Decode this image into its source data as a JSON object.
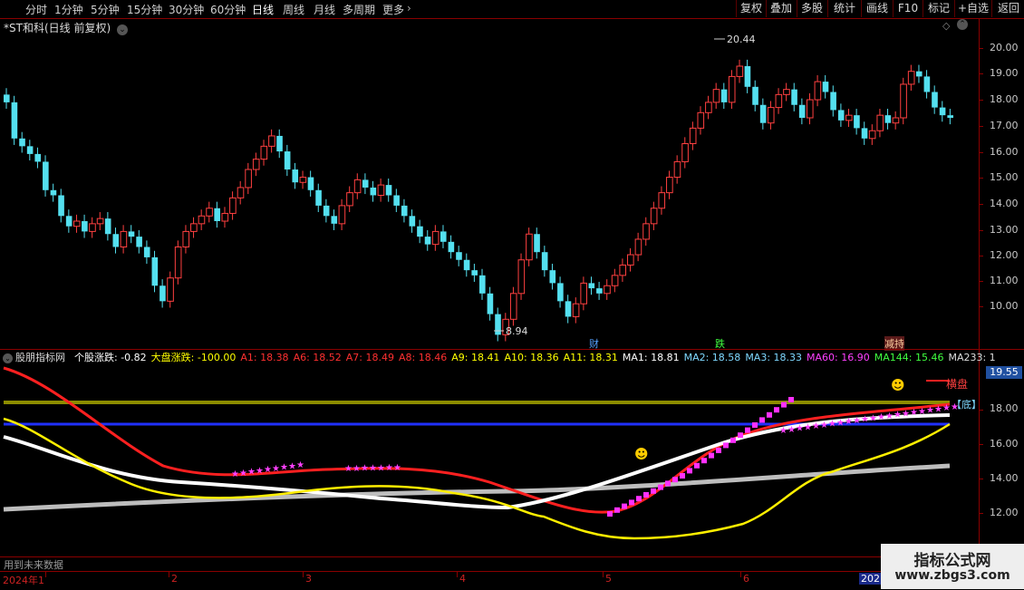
{
  "toolbar": {
    "periods": [
      "分时",
      "1分钟",
      "5分钟",
      "15分钟",
      "30分钟",
      "60分钟",
      "日线",
      "周线",
      "月线",
      "多周期",
      "更多"
    ],
    "active_period": "日线",
    "buttons": [
      "复权",
      "叠加",
      "多股",
      "统计",
      "画线",
      "F10",
      "标记",
      "+自选",
      "返回"
    ]
  },
  "stock": {
    "title": "*ST和科(日线 前复权)"
  },
  "price_axis": {
    "labels": [
      "20.00",
      "19.00",
      "18.00",
      "17.00",
      "16.00",
      "15.00",
      "14.00",
      "13.00",
      "12.00",
      "11.00",
      "10.00"
    ]
  },
  "annotations": {
    "high": "20.44",
    "low": "8.94",
    "event_1": "财",
    "event_2": "跌",
    "event_3": "减持"
  },
  "indicator": {
    "name": "股朋指标网",
    "items": [
      {
        "text": "个股涨跌: -0.82",
        "color": "#ffffff"
      },
      {
        "text": "大盘涨跌: -100.00",
        "color": "#ffff00"
      },
      {
        "text": "A1: 18.38",
        "color": "#ff3030"
      },
      {
        "text": "A6: 18.52",
        "color": "#ff3030"
      },
      {
        "text": "A7: 18.49",
        "color": "#ff3030"
      },
      {
        "text": "A8: 18.46",
        "color": "#ff3030"
      },
      {
        "text": "A9: 18.41",
        "color": "#ffff00"
      },
      {
        "text": "A10: 18.36",
        "color": "#ffff00"
      },
      {
        "text": "A11: 18.31",
        "color": "#ffff00"
      },
      {
        "text": "MA1: 18.81",
        "color": "#ffffff"
      },
      {
        "text": "MA2: 18.58",
        "color": "#7fd8ff"
      },
      {
        "text": "MA3: 18.33",
        "color": "#7fd8ff"
      },
      {
        "text": "MA60: 16.90",
        "color": "#ff40ff"
      },
      {
        "text": "MA144: 15.46",
        "color": "#40ff40"
      },
      {
        "text": "MA233: 1",
        "color": "#dddddd"
      }
    ],
    "axis_labels": [
      "18.00",
      "16.00",
      "14.00",
      "12.00"
    ],
    "current_value": "19.55",
    "tag_bottom": "【底】",
    "tag_side": "横盘"
  },
  "future_note": "用到未来数据",
  "time_axis": {
    "labels": [
      "2024年1",
      "2",
      "3",
      "4",
      "5",
      "6",
      "202"
    ]
  },
  "watermark": {
    "title": "指标公式网",
    "url": "www.zbgs3.com"
  },
  "colors": {
    "up": "#ff4040",
    "down": "#54e0f0",
    "frame": "#8a0000"
  }
}
